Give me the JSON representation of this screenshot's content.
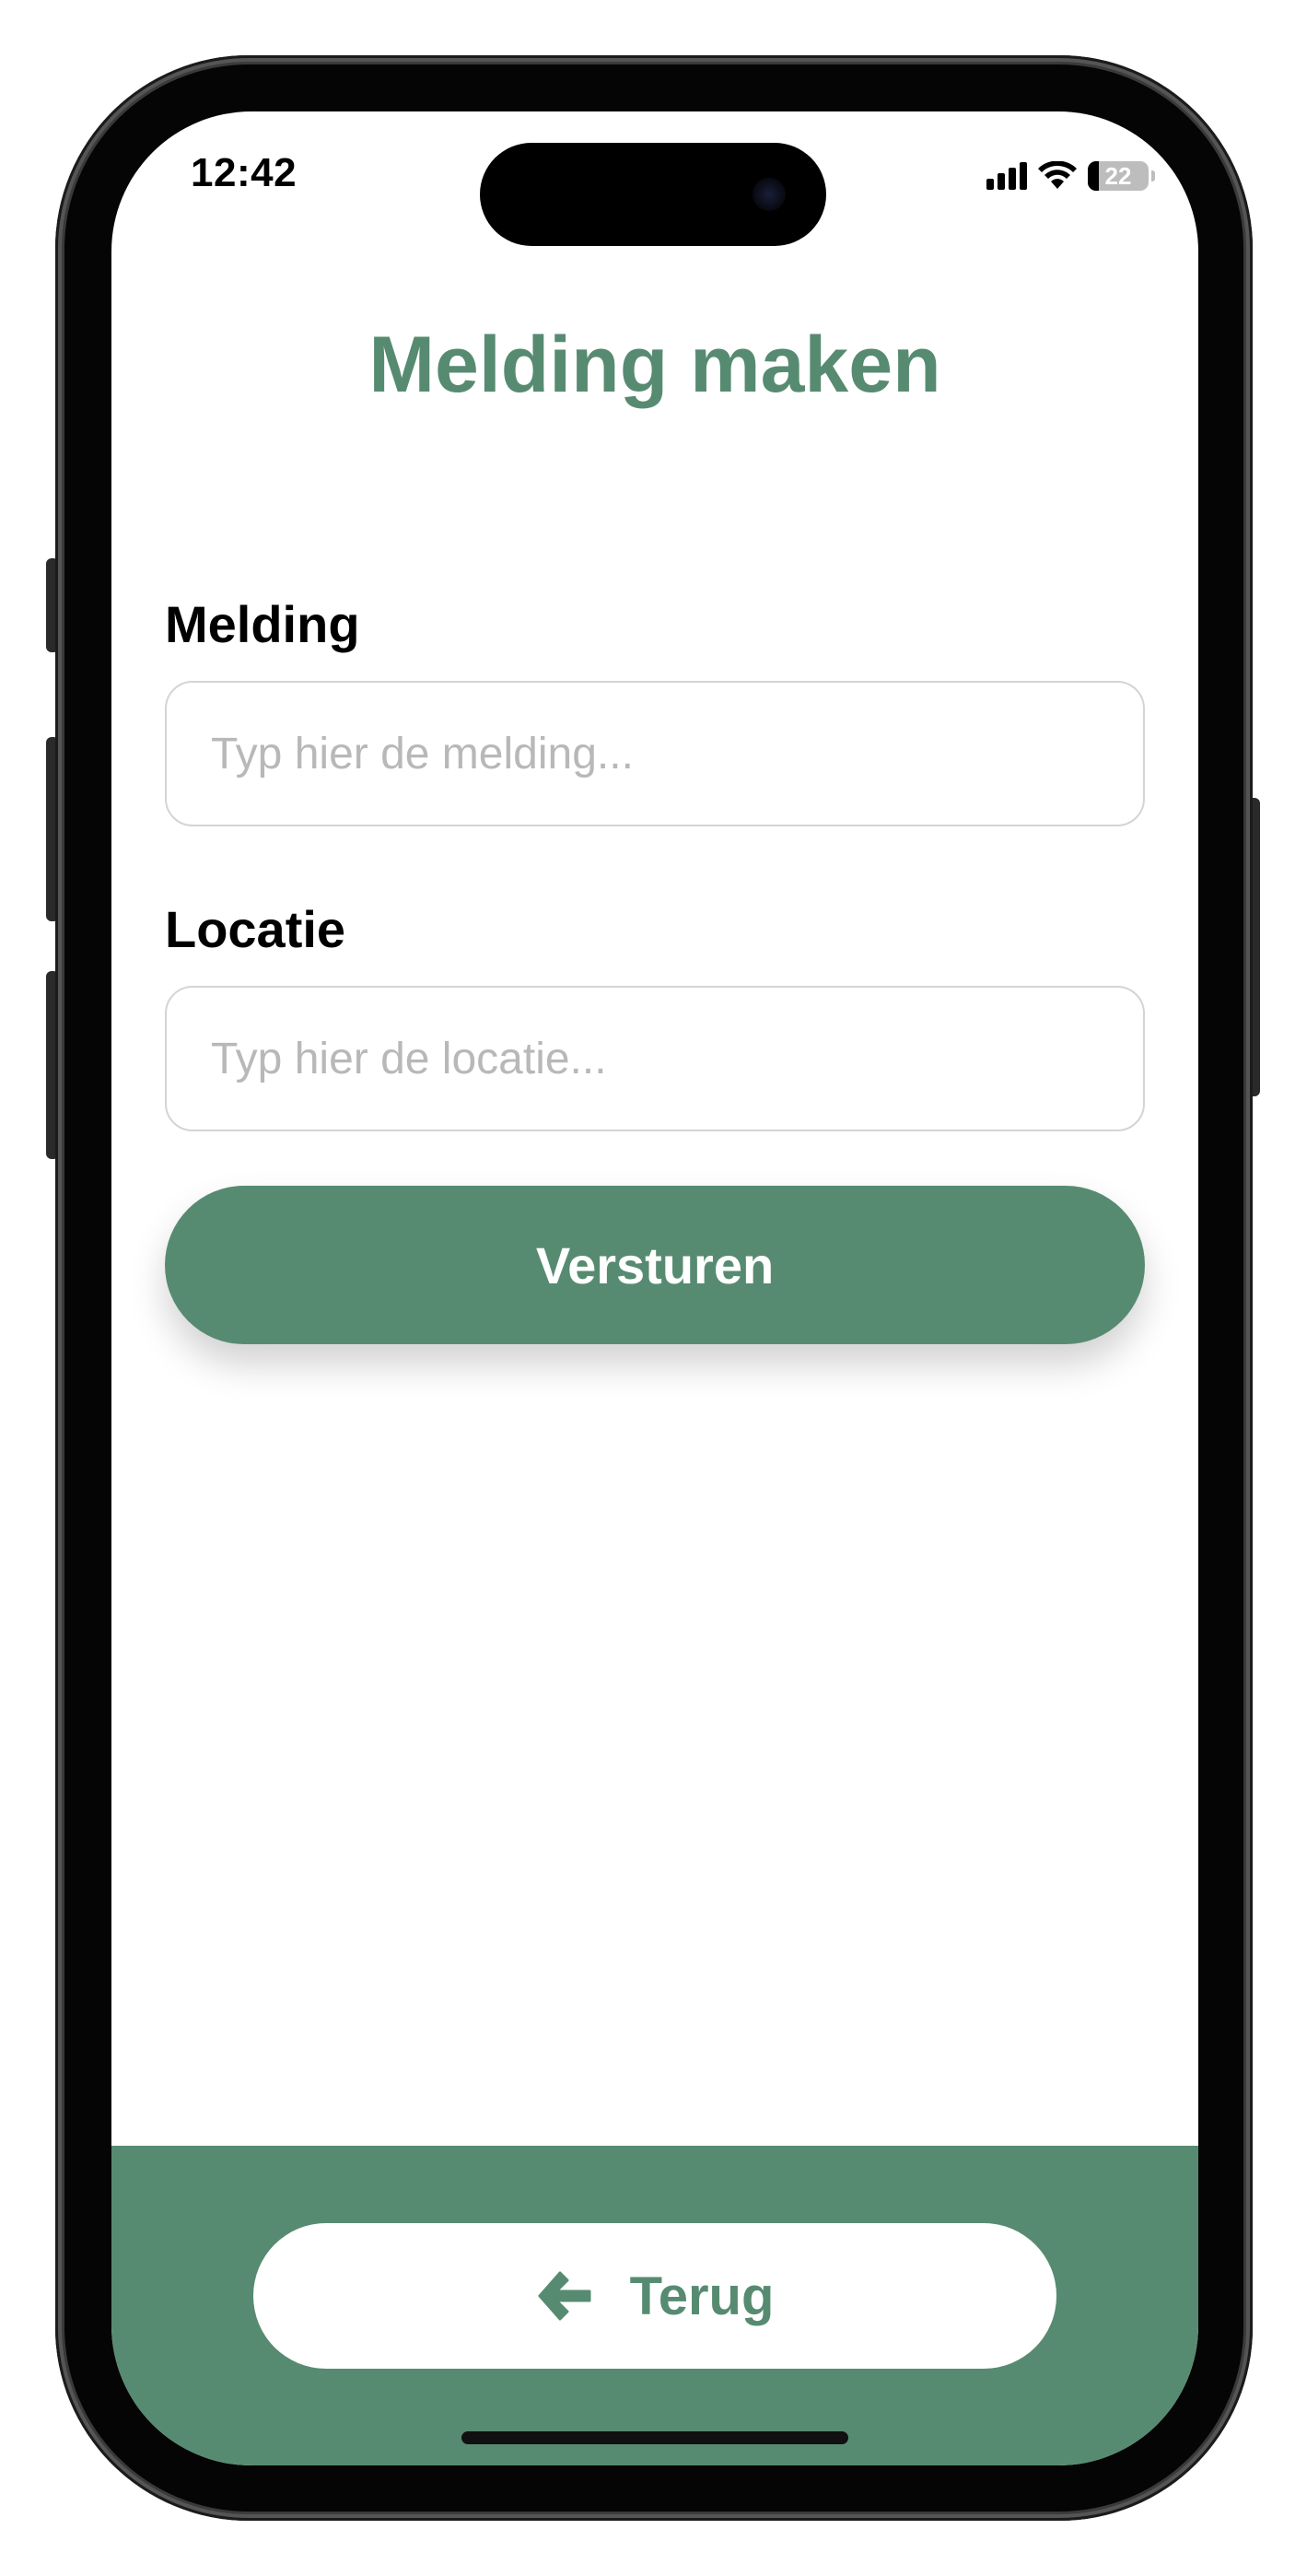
{
  "status_bar": {
    "time": "12:42",
    "battery_level": "22",
    "icons": [
      "signal-icon",
      "wifi-icon",
      "battery-icon"
    ]
  },
  "header": {
    "title": "Melding maken"
  },
  "form": {
    "melding": {
      "label": "Melding",
      "value": "",
      "placeholder": "Typ hier de melding..."
    },
    "locatie": {
      "label": "Locatie",
      "value": "",
      "placeholder": "Typ hier de locatie..."
    },
    "submit_label": "Versturen"
  },
  "footer": {
    "back_label": "Terug",
    "back_icon": "arrow-left-icon"
  },
  "colors": {
    "accent": "#578b71",
    "background": "#ffffff",
    "label_text": "#000000",
    "placeholder_text": "#b8b8b8",
    "input_border": "#d4d4d4"
  }
}
